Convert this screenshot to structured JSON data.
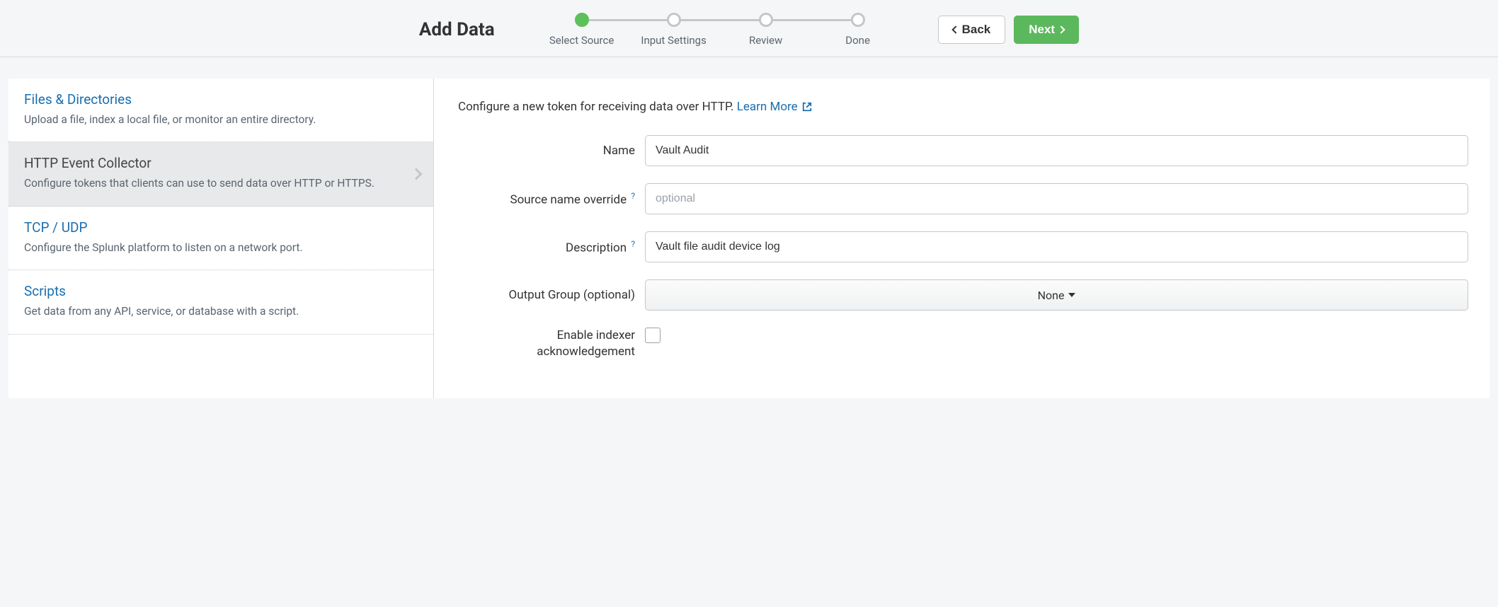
{
  "header": {
    "title": "Add Data",
    "steps": [
      "Select Source",
      "Input Settings",
      "Review",
      "Done"
    ],
    "active_step_index": 0,
    "back_label": "Back",
    "next_label": "Next"
  },
  "sidebar": {
    "items": [
      {
        "title": "Files & Directories",
        "desc": "Upload a file, index a local file, or monitor an entire directory.",
        "selected": false
      },
      {
        "title": "HTTP Event Collector",
        "desc": "Configure tokens that clients can use to send data over HTTP or HTTPS.",
        "selected": true
      },
      {
        "title": "TCP / UDP",
        "desc": "Configure the Splunk platform to listen on a network port.",
        "selected": false
      },
      {
        "title": "Scripts",
        "desc": "Get data from any API, service, or database with a script.",
        "selected": false
      }
    ]
  },
  "main": {
    "intro_text": "Configure a new token for receiving data over HTTP. ",
    "learn_more": "Learn More",
    "form": {
      "name_label": "Name",
      "name_value": "Vault Audit",
      "source_override_label": "Source name override",
      "source_override_placeholder": "optional",
      "source_override_value": "",
      "description_label": "Description",
      "description_value": "Vault file audit device log",
      "output_group_label": "Output Group (optional)",
      "output_group_value": "None",
      "indexer_ack_label": "Enable indexer acknowledgement"
    }
  }
}
